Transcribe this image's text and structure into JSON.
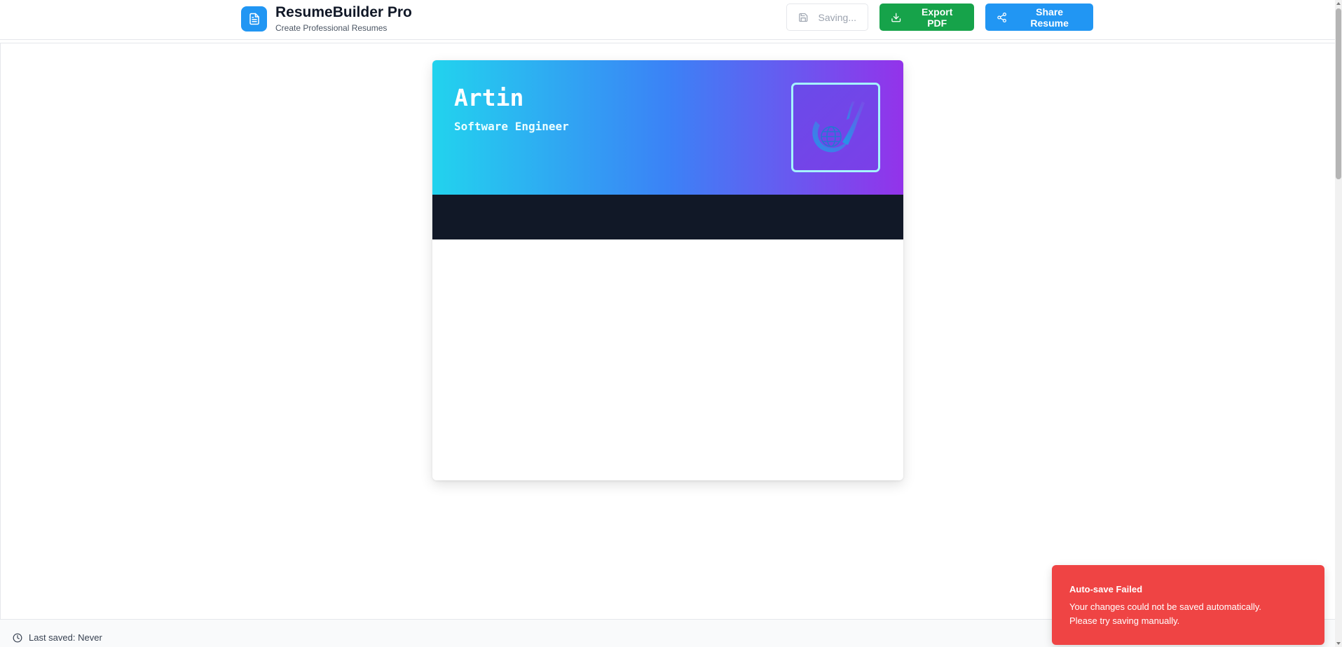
{
  "header": {
    "brand_title": "ResumeBuilder Pro",
    "brand_subtitle": "Create Professional Resumes",
    "saving_label": "Saving...",
    "export_label": "Export PDF",
    "share_label": "Share Resume"
  },
  "resume": {
    "name": "Artin",
    "role": "Software Engineer",
    "photo_icon": "globe-swoosh-logo"
  },
  "footer": {
    "last_saved": "Last saved: Never"
  },
  "toast": {
    "title": "Auto-save Failed",
    "line1": "Your changes could not be saved automatically.",
    "line2": "Please try saving manually."
  },
  "colors": {
    "brand_blue": "#2196f3",
    "export_green": "#16a34a",
    "toast_red": "#ef4444",
    "resume_dark_bar": "#111827",
    "gradient_start": "#22d3ee",
    "gradient_end": "#9333ea"
  }
}
